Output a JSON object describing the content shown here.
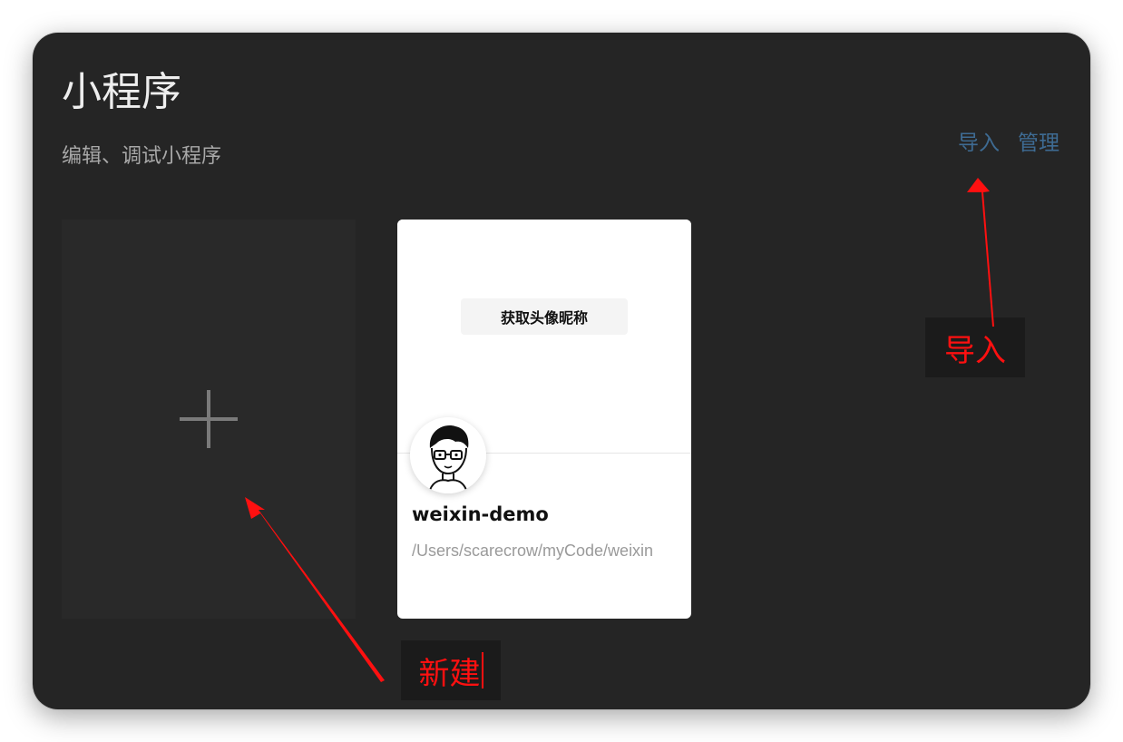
{
  "header": {
    "title": "小程序",
    "subtitle": "编辑、调试小程序"
  },
  "actions": {
    "import_label": "导入",
    "manage_label": "管理"
  },
  "new_card": {
    "icon": "plus-icon"
  },
  "project": {
    "preview_button": "获取头像昵称",
    "name": "weixin-demo",
    "path": "/Users/scarecrow/myCode/weixin"
  },
  "annotations": {
    "import_label": "导入",
    "new_label": "新建",
    "color": "#ff1010"
  },
  "colors": {
    "window_bg": "#252525",
    "link": "#3e6b93",
    "annotation": "#ff1010"
  }
}
